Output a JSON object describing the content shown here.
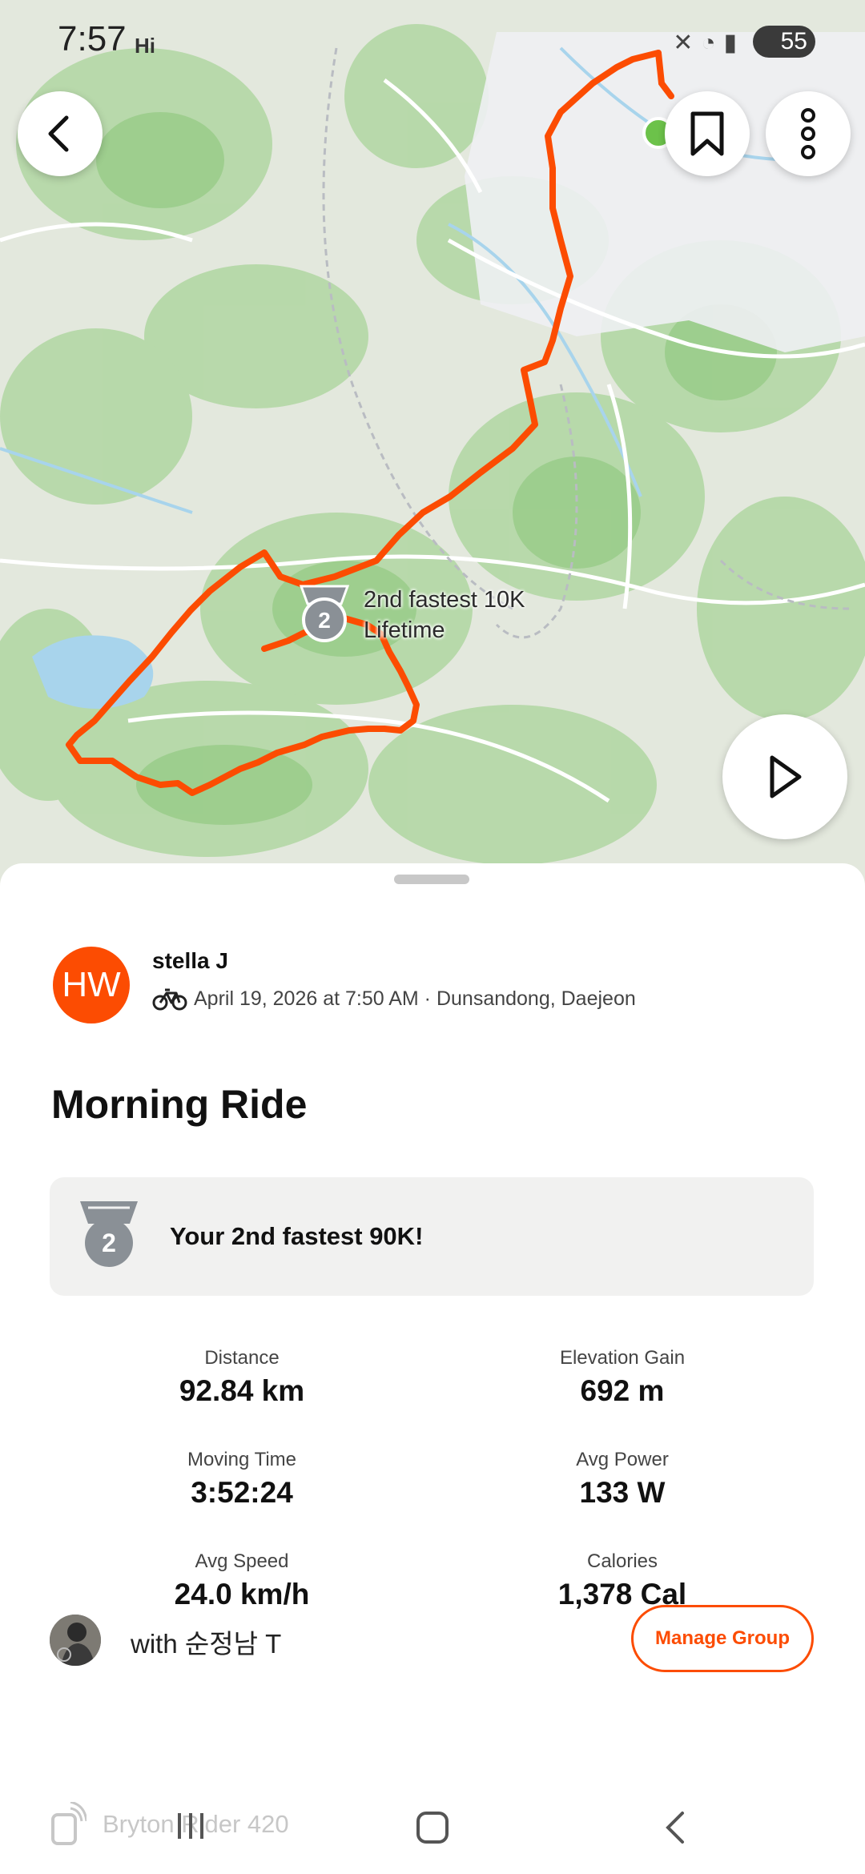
{
  "status_bar": {
    "time": "7:57",
    "indicator": "Hi",
    "battery": "55"
  },
  "map": {
    "segment_label_line1": "2nd fastest 10K",
    "segment_label_line2": "Lifetime",
    "medal_rank": "2"
  },
  "activity": {
    "athlete_initials": "HW",
    "athlete_name": "stella J",
    "meta": "April 19, 2026 at 7:50 AM · Dunsandong, Daejeon",
    "title": "Morning Ride"
  },
  "achievement": {
    "rank": "2",
    "text": "Your 2nd fastest 90K!"
  },
  "stats": [
    {
      "label": "Distance",
      "value": "92.84 km"
    },
    {
      "label": "Elevation Gain",
      "value": "692 m"
    },
    {
      "label": "Moving Time",
      "value": "3:52:24"
    },
    {
      "label": "Avg Power",
      "value": "133 W"
    },
    {
      "label": "Avg Speed",
      "value": "24.0 km/h"
    },
    {
      "label": "Calories",
      "value": "1,378 Cal"
    }
  ],
  "group": {
    "with_text": "with 순정남 T",
    "manage_label": "Manage Group"
  },
  "device": {
    "name": "Bryton Rider 420"
  },
  "colors": {
    "accent": "#fc4c02",
    "route": "#fc4c02",
    "medal": "#8a9096"
  }
}
